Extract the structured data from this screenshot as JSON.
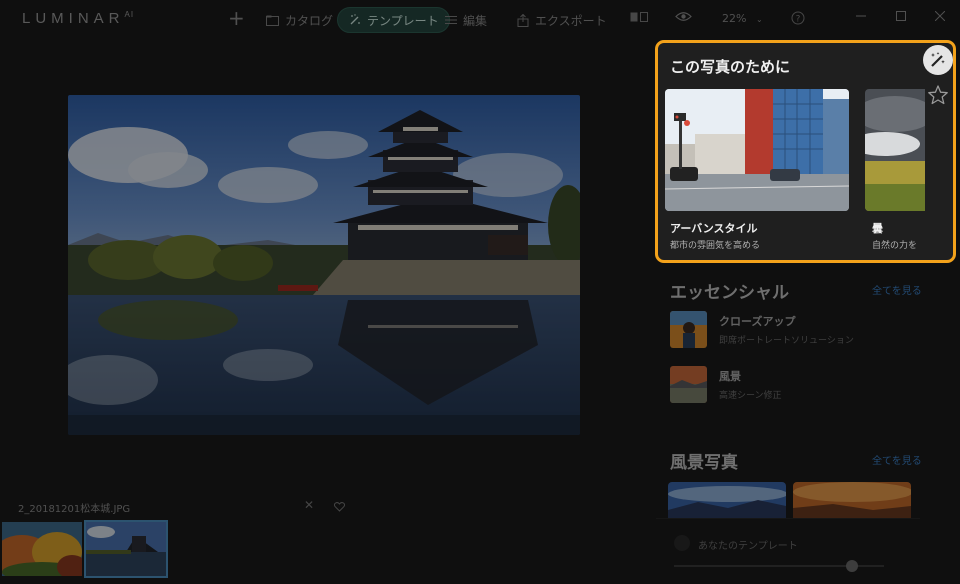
{
  "app": {
    "logo": "LUMINAR",
    "logo_sup": "AI"
  },
  "nav": {
    "add_label": "+",
    "catalog": "カタログ",
    "templates": "テンプレート",
    "edit": "編集",
    "export": "エクスポート",
    "zoom": "22%"
  },
  "photo": {
    "filename": "2_20181201松本城.JPG"
  },
  "for_this_photo": {
    "title": "この写真のために",
    "cards": [
      {
        "title": "アーバンスタイル",
        "subtitle": "都市の雰囲気を高める"
      },
      {
        "title": "曇",
        "subtitle": "自然の力を"
      }
    ]
  },
  "essentials": {
    "title": "エッセンシャル",
    "see_all": "全てを見る",
    "items": [
      {
        "title": "クローズアップ",
        "subtitle": "即席ポートレートソリューション"
      },
      {
        "title": "風景",
        "subtitle": "高速シーン修正"
      }
    ]
  },
  "landscape": {
    "title": "風景写真",
    "see_all": "全てを見る"
  },
  "my_templates": {
    "label": "あなたのテンプレート"
  },
  "icons": [
    "plus-icon",
    "catalog-icon",
    "template-wand-icon",
    "edit-sliders-icon",
    "export-icon",
    "compare-icon",
    "eye-icon",
    "help-icon",
    "minimize-icon",
    "maximize-icon",
    "close-icon",
    "reject-x-icon",
    "heart-icon",
    "magic-wand-icon",
    "star-icon"
  ]
}
